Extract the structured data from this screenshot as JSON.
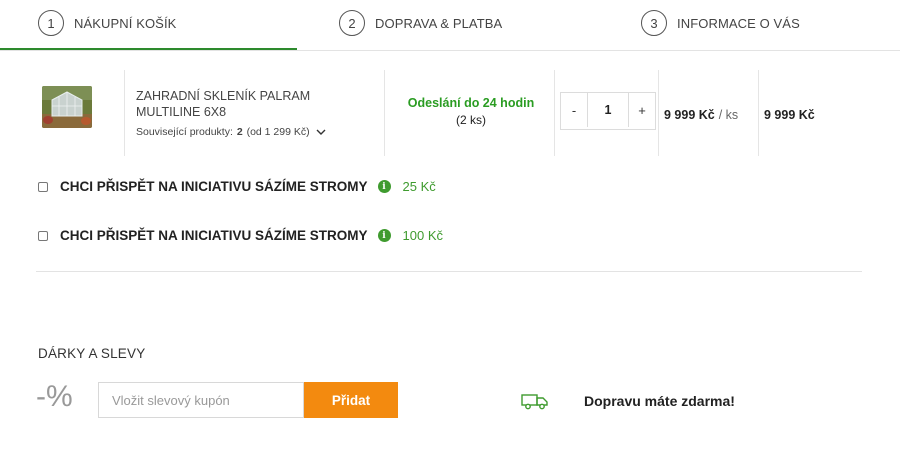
{
  "steps": [
    {
      "num": "1",
      "label": "NÁKUPNÍ KOŠÍK"
    },
    {
      "num": "2",
      "label": "DOPRAVA & PLATBA"
    },
    {
      "num": "3",
      "label": "INFORMACE O VÁS"
    }
  ],
  "cart_item": {
    "name": "ZAHRADNÍ SKLENÍK PALRAM MULTILINE 6X8",
    "related_prefix": "Související produkty:",
    "related_count": "2",
    "related_suffix": "(od 1 299 Kč)",
    "shipping_title": "Odeslání do 24 hodin",
    "shipping_qty": "(2 ks)",
    "qty_minus": "-",
    "qty_value": "1",
    "qty_plus": "+",
    "unit_price": "9 999 Kč",
    "unit_suffix": "/ ks",
    "total_price": "9 999 Kč"
  },
  "donations": [
    {
      "label": "CHCI PŘISPĚT NA INICIATIVU SÁZÍME STROMY",
      "price": "25 Kč"
    },
    {
      "label": "CHCI PŘISPĚT NA INICIATIVU SÁZÍME STROMY",
      "price": "100 Kč"
    }
  ],
  "gifts": {
    "title": "DÁRKY A SLEVY",
    "percent_symbol": "-%",
    "coupon_placeholder": "Vložit slevový kupón",
    "add_button": "Přidat",
    "free_shipping": "Dopravu máte zdarma!"
  },
  "colors": {
    "green": "#2a9c22",
    "orange": "#f38a0f"
  },
  "icons": {
    "info": "info-icon",
    "truck": "truck-icon",
    "chevron": "chevron-down-icon"
  }
}
